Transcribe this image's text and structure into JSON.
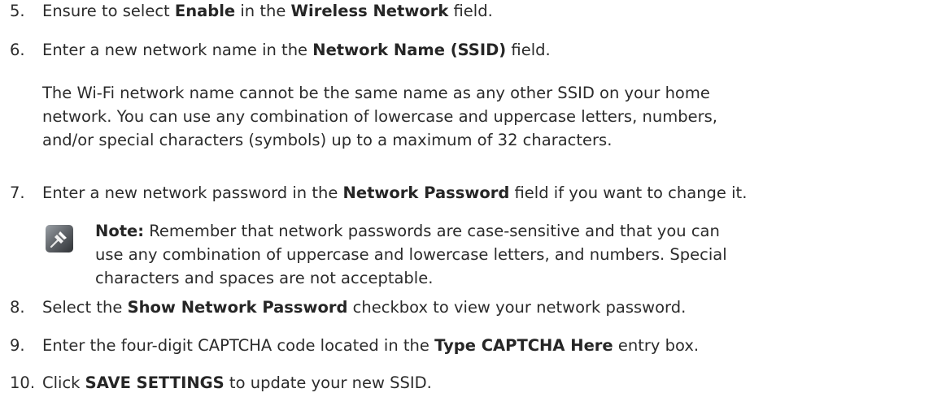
{
  "steps": [
    {
      "number": "5.",
      "parts": [
        "Ensure to select ",
        "Enable",
        " in the ",
        "Wireless Network",
        " field."
      ]
    },
    {
      "number": "6.",
      "parts": [
        "Enter a new network name in the ",
        "Network Name (SSID)",
        " field."
      ]
    },
    {
      "number": "7.",
      "parts": [
        "Enter a new network password in the ",
        "Network Password",
        " field if you want to change it."
      ]
    },
    {
      "number": "8.",
      "parts": [
        "Select the ",
        "Show Network Password",
        " checkbox to view your network password."
      ]
    },
    {
      "number": "9.",
      "parts": [
        "Enter the four-digit CAPTCHA code located in the ",
        "Type CAPTCHA Here",
        " entry box."
      ]
    },
    {
      "number": "10.",
      "parts": [
        "Click ",
        "SAVE SETTINGS",
        " to update your new SSID."
      ]
    }
  ],
  "ssid_paragraph": [
    "The Wi-Fi network name cannot be the same name as any other SSID on your home",
    "network. You can use any combination of lowercase and uppercase letters, numbers,",
    "and/or special characters (symbols) up to a maximum of 32 characters."
  ],
  "note": {
    "icon": "pushpin-icon",
    "label": "Note:",
    "lines": [
      " Remember that network passwords are case-sensitive and that you can",
      "use any combination of uppercase and lowercase letters, and numbers. Special",
      "characters and spaces are not acceptable."
    ]
  }
}
